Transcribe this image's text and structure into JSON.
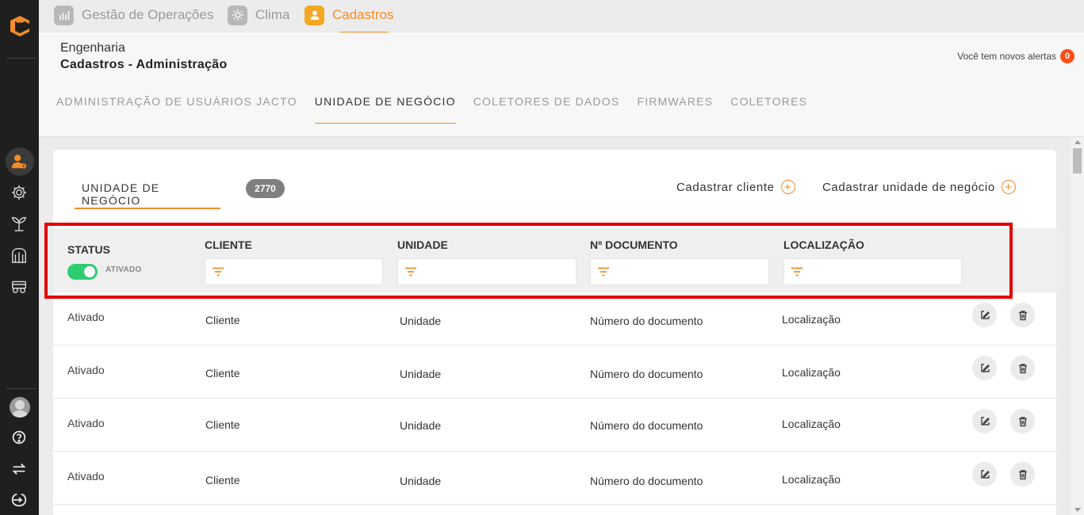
{
  "top_tabs": [
    {
      "label": "Gestão de Operações",
      "icon": "operations-chart-icon",
      "active": false
    },
    {
      "label": "Clima",
      "icon": "sun-icon",
      "active": false
    },
    {
      "label": "Cadastros",
      "icon": "user-icon",
      "active": true
    }
  ],
  "breadcrumb": {
    "parent": "Engenharia",
    "current": "Cadastros - Administração"
  },
  "alerts": {
    "label": "Você tem novos alertas",
    "count": "0"
  },
  "sub_tabs": [
    {
      "label": "ADMINISTRAÇÃO DE USUÁRIOS JACTO",
      "active": false
    },
    {
      "label": "UNIDADE DE NEGÓCIO",
      "active": true
    },
    {
      "label": "COLETORES DE DADOS",
      "active": false
    },
    {
      "label": "FIRMWARES",
      "active": false
    },
    {
      "label": "COLETORES",
      "active": false
    }
  ],
  "card": {
    "tab_label": "UNIDADE DE NEGÓCIO",
    "count": "2770",
    "actions": {
      "add_client": "Cadastrar cliente",
      "add_unit": "Cadastrar unidade de negócio"
    }
  },
  "filters": {
    "status_header": "STATUS",
    "status_toggle_label": "ATIVADO",
    "status_toggle_on": true,
    "columns": [
      "CLIENTE",
      "UNIDADE",
      "Nº DOCUMENTO",
      "LOCALIZAÇÃO"
    ]
  },
  "rows": [
    {
      "status": "Ativado",
      "cliente": "Cliente",
      "unidade": "Unidade",
      "documento": "Número do documento",
      "localizacao": "Localização"
    },
    {
      "status": "Ativado",
      "cliente": "Cliente",
      "unidade": "Unidade",
      "documento": "Número do documento",
      "localizacao": "Localização"
    },
    {
      "status": "Ativado",
      "cliente": "Cliente",
      "unidade": "Unidade",
      "documento": "Número do documento",
      "localizacao": "Localização"
    },
    {
      "status": "Ativado",
      "cliente": "Cliente",
      "unidade": "Unidade",
      "documento": "Número do documento",
      "localizacao": "Localização"
    }
  ],
  "colors": {
    "accent": "#f28c28",
    "toggle_on": "#2ecc71",
    "alert_badge": "#ff4e1a",
    "highlight": "#e60000",
    "sidebar": "#1f1f1f"
  }
}
